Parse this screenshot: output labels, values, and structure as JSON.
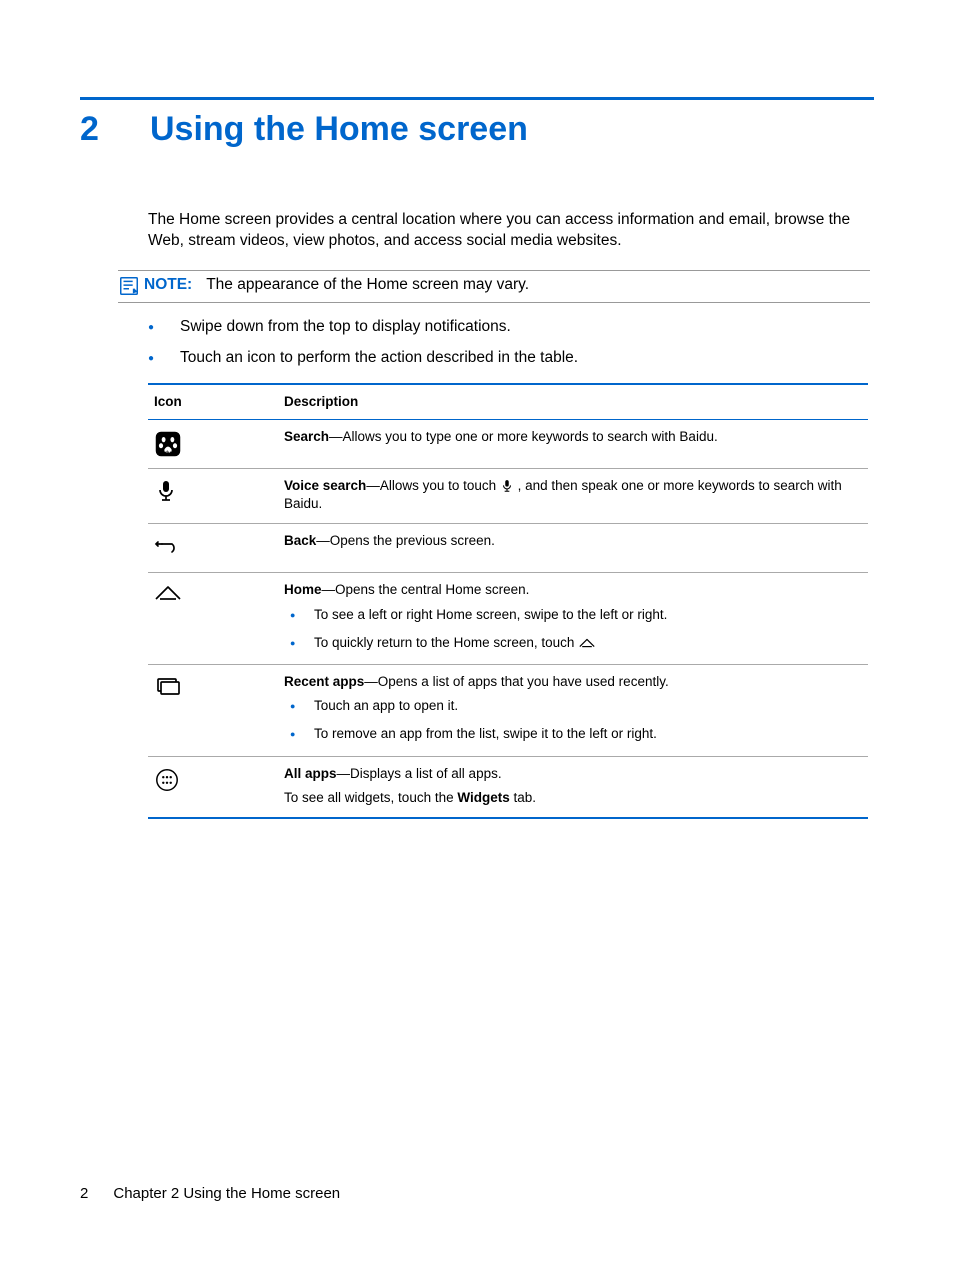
{
  "chapter": {
    "number": "2",
    "title": "Using the Home screen"
  },
  "intro": "The Home screen provides a central location where you can access information and email, browse the Web, stream videos, view photos, and access social media websites.",
  "note": {
    "label": "NOTE:",
    "text": "The appearance of the Home screen may vary."
  },
  "bullets": [
    "Swipe down from the top to display notifications.",
    "Touch an icon to perform the action described in the table."
  ],
  "table": {
    "headers": {
      "icon": "Icon",
      "desc": "Description"
    },
    "rows": {
      "search": {
        "bold": "Search",
        "rest": "—Allows you to type one or more keywords to search with Baidu."
      },
      "voice": {
        "bold": "Voice search",
        "before": "—Allows you to touch ",
        "after": " , and then speak one or more keywords to search with Baidu."
      },
      "back": {
        "bold": "Back",
        "rest": "—Opens the previous screen."
      },
      "home": {
        "bold": "Home",
        "rest": "—Opens the central Home screen.",
        "sub": [
          "To see a left or right Home screen, swipe to the left or right.",
          "To quickly return to the Home screen, touch "
        ]
      },
      "recent": {
        "bold": "Recent apps",
        "rest": "—Opens a list of apps that you have used recently.",
        "sub": [
          "Touch an app to open it.",
          "To remove an app from the list, swipe it to the left or right."
        ]
      },
      "allapps": {
        "bold": "All apps",
        "rest": "—Displays a list of all apps.",
        "line2a": "To see all widgets, touch the ",
        "line2bold": "Widgets",
        "line2b": " tab."
      }
    }
  },
  "footer": {
    "page": "2",
    "label": "Chapter 2   Using the Home screen"
  }
}
